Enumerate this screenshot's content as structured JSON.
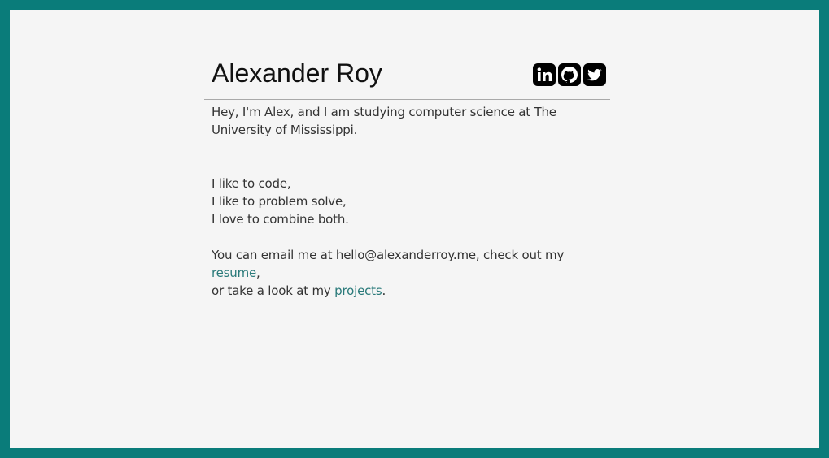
{
  "header": {
    "name": "Alexander Roy",
    "social": [
      {
        "label": "LinkedIn",
        "icon": "linkedin-icon"
      },
      {
        "label": "GitHub",
        "icon": "github-icon"
      },
      {
        "label": "Twitter",
        "icon": "twitter-icon"
      }
    ]
  },
  "intro": "Hey, I'm Alex, and I am studying computer science at The University of Mississippi.",
  "likes": [
    "I like to code,",
    "I like to problem solve,",
    "I love to combine both."
  ],
  "contact": {
    "prefix": "You can email me at hello@alexanderroy.me, check out my ",
    "resume_link": "resume",
    "middle": ",",
    "line2_prefix": "or take a look at my ",
    "projects_link": "projects",
    "suffix": "."
  },
  "colors": {
    "border": "#0a7c7a",
    "background": "#f5f5f5",
    "link": "#2a7a7a"
  }
}
